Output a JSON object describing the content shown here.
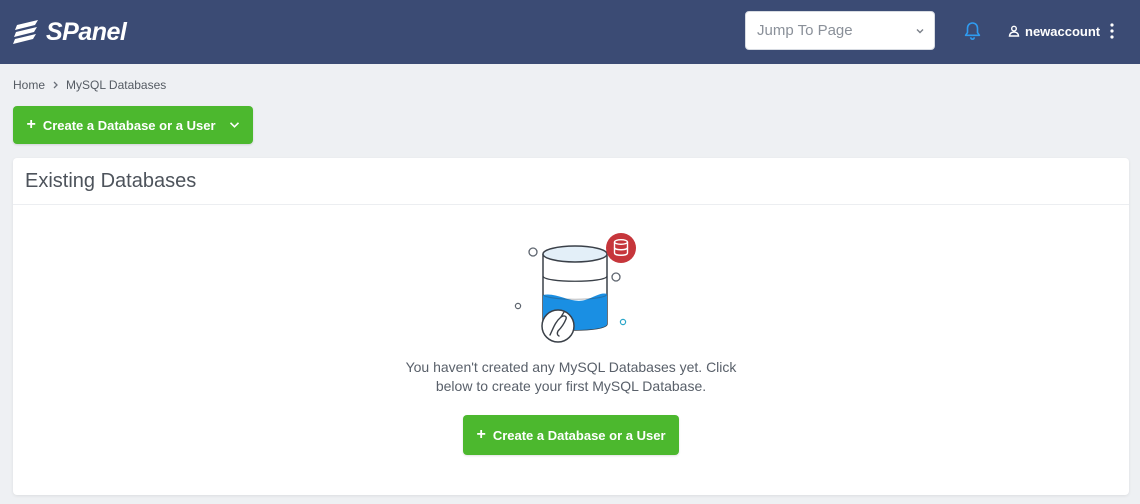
{
  "header": {
    "brand": "SPanel",
    "jump_placeholder": "Jump To Page",
    "username": "newaccount"
  },
  "icons": {
    "logo": "spanel-logo-icon",
    "jump_chevron": "chevron-down-icon",
    "bell": "bell-icon",
    "user": "user-icon",
    "menu": "kebab-menu-icon",
    "breadcrumb_separator": "chevron-right-icon",
    "plus": "plus-icon",
    "dropdown": "chevron-down-icon",
    "illustration": "database-illustration"
  },
  "breadcrumb": {
    "home": "Home",
    "current": "MySQL Databases"
  },
  "toolbar": {
    "create_label": "Create a Database or a User",
    "plus_glyph": "+"
  },
  "panel": {
    "title": "Existing Databases",
    "empty_line1": "You haven't created any MySQL Databases yet. Click",
    "empty_line2": "below to create your first MySQL Database.",
    "create_label": "Create a Database or a User",
    "plus_glyph": "+"
  },
  "colors": {
    "header_bg": "#3b4b74",
    "page_bg": "#eef0f3",
    "accent_green": "#4cb82e",
    "bell_blue": "#2f9bf0",
    "db_badge_red": "#c6363b",
    "db_water_blue": "#1a8fe3"
  }
}
